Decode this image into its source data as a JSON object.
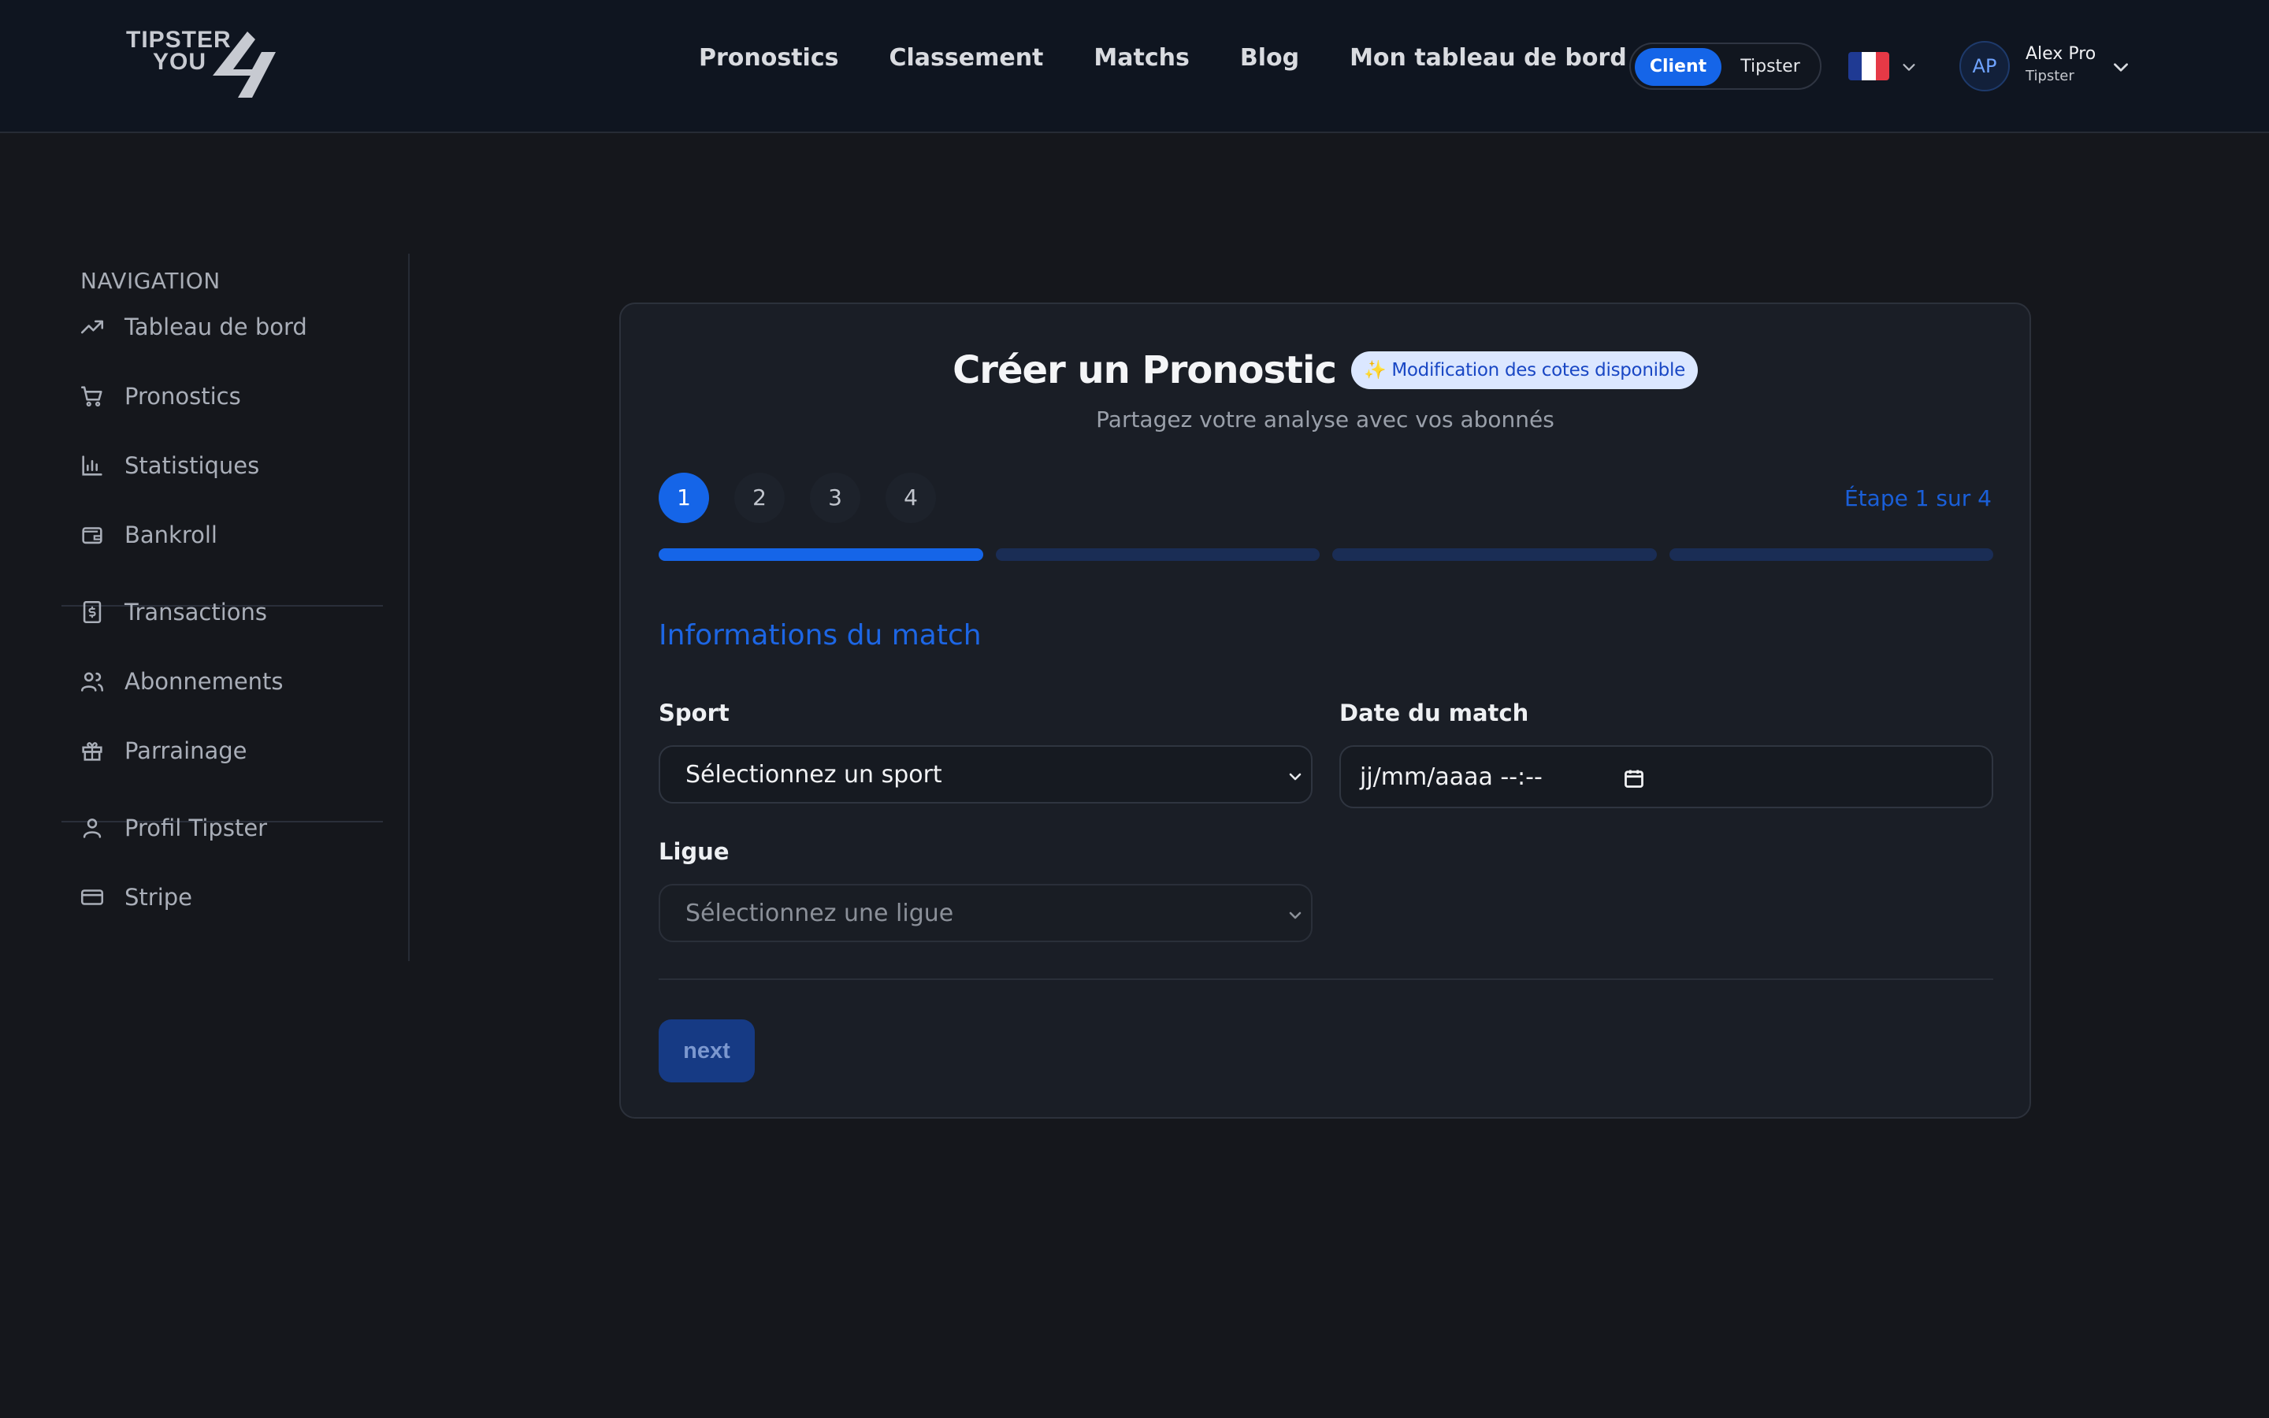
{
  "brand": {
    "line1": "TIPSTER",
    "line2": "YOU"
  },
  "nav": [
    "Pronostics",
    "Classement",
    "Matchs",
    "Blog",
    "Mon tableau de bord"
  ],
  "role_toggle": {
    "client": "Client",
    "tipster": "Tipster",
    "active": "Client"
  },
  "language": {
    "flag_colors": [
      "#1f3a93",
      "#ffffff",
      "#e63946"
    ]
  },
  "user": {
    "initials": "AP",
    "name": "Alex Pro",
    "role": "Tipster"
  },
  "sidebar": {
    "title": "NAVIGATION",
    "items": [
      {
        "label": "Tableau de bord",
        "icon": "trending-up-icon"
      },
      {
        "label": "Pronostics",
        "icon": "cart-icon"
      },
      {
        "label": "Statistiques",
        "icon": "bar-chart-icon"
      },
      {
        "label": "Bankroll",
        "icon": "wallet-icon"
      },
      {
        "label": "Transactions",
        "icon": "receipt-dollar-icon"
      },
      {
        "label": "Abonnements",
        "icon": "users-icon"
      },
      {
        "label": "Parrainage",
        "icon": "gift-icon"
      },
      {
        "label": "Profil Tipster",
        "icon": "user-icon"
      },
      {
        "label": "Stripe",
        "icon": "credit-card-icon"
      }
    ]
  },
  "card": {
    "title": "Créer un Pronostic",
    "badge": "✨ Modification des cotes disponible",
    "subtitle": "Partagez votre analyse avec vos abonnés",
    "steps": [
      "1",
      "2",
      "3",
      "4"
    ],
    "current_step": 1,
    "step_count": "Étape 1 sur 4",
    "section_title": "Informations du match",
    "sport": {
      "label": "Sport",
      "value": "Sélectionnez un sport"
    },
    "date": {
      "label": "Date du match",
      "value": "jj/mm/aaaa --:--"
    },
    "league": {
      "label": "Ligue",
      "value": "Sélectionnez une ligue"
    },
    "next_label": "next"
  },
  "colors": {
    "accent": "#1565e8",
    "background": "#15171c",
    "card": "#1a1e26"
  }
}
